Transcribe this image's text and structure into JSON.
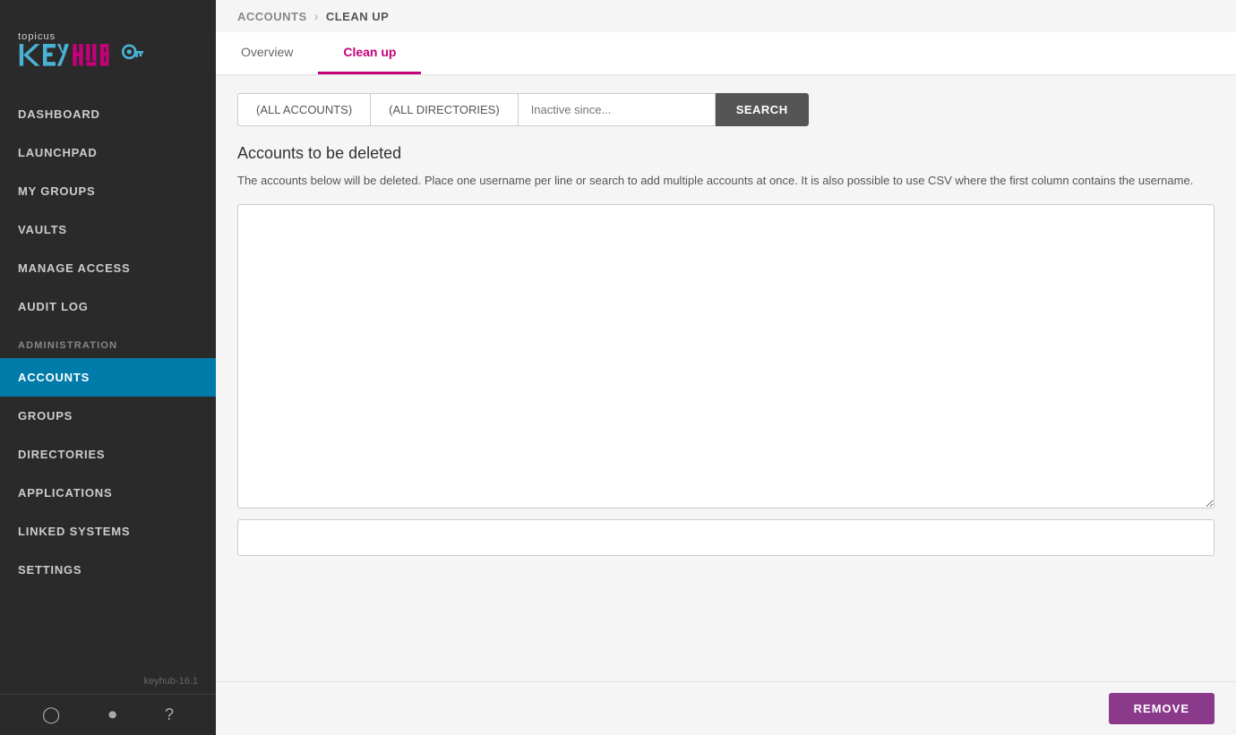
{
  "sidebar": {
    "logo_alt": "Topicus KeyHub",
    "nav_items": [
      {
        "label": "DASHBOARD",
        "id": "dashboard",
        "active": false
      },
      {
        "label": "LAUNCHPAD",
        "id": "launchpad",
        "active": false
      },
      {
        "label": "MY GROUPS",
        "id": "my-groups",
        "active": false
      },
      {
        "label": "VAULTS",
        "id": "vaults",
        "active": false
      },
      {
        "label": "MANAGE ACCESS",
        "id": "manage-access",
        "active": false
      },
      {
        "label": "AUDIT LOG",
        "id": "audit-log",
        "active": false
      }
    ],
    "admin_section_label": "ADMINISTRATION",
    "admin_items": [
      {
        "label": "ACCOUNTS",
        "id": "accounts",
        "active": true
      },
      {
        "label": "GROUPS",
        "id": "groups",
        "active": false
      },
      {
        "label": "DIRECTORIES",
        "id": "directories",
        "active": false
      },
      {
        "label": "APPLICATIONS",
        "id": "applications",
        "active": false
      },
      {
        "label": "LINKED SYSTEMS",
        "id": "linked-systems",
        "active": false
      },
      {
        "label": "SETTINGS",
        "id": "settings",
        "active": false
      }
    ],
    "version": "keyhub-16.1",
    "bottom_icons": [
      "user-icon",
      "power-icon",
      "help-icon"
    ]
  },
  "breadcrumb": {
    "parent": "ACCOUNTS",
    "separator": "›",
    "current": "CLEAN UP"
  },
  "tabs": [
    {
      "label": "Overview",
      "id": "overview",
      "active": false
    },
    {
      "label": "Clean up",
      "id": "cleanup",
      "active": true
    }
  ],
  "filters": {
    "accounts_btn": "(ALL ACCOUNTS)",
    "directories_btn": "(ALL DIRECTORIES)",
    "inactive_placeholder": "Inactive since...",
    "search_btn": "SEARCH"
  },
  "section": {
    "title": "Accounts to be deleted",
    "description": "The accounts below will be deleted. Place one username per line or search to add multiple accounts at once. It is also possible to use CSV where the first column contains the username.",
    "textarea_placeholder": "",
    "input_placeholder": ""
  },
  "actions": {
    "remove_btn": "REMOVE"
  }
}
